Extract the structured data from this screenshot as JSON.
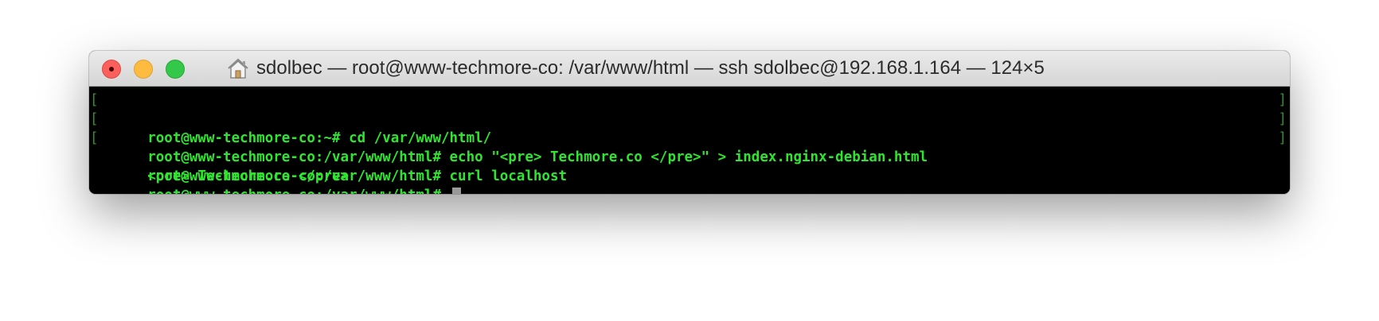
{
  "window": {
    "title": "sdolbec — root@www-techmore-co: /var/www/html — ssh sdolbec@192.168.1.164 — 124×5",
    "icon": "home-icon"
  },
  "terminal": {
    "colors": {
      "background": "#000000",
      "text": "#2ee62e",
      "cursor": "#9a9a9a"
    },
    "lines": [
      {
        "text": "root@www-techmore-co:~# cd /var/www/html/",
        "bracketed": true
      },
      {
        "text": "root@www-techmore-co:/var/www/html# echo \"<pre> Techmore.co </pre>\" > index.nginx-debian.html",
        "bracketed": true
      },
      {
        "text": "root@www-techmore-co:/var/www/html# curl localhost",
        "bracketed": true
      },
      {
        "text": "<pre> Techmore.co </pre>",
        "bracketed": false
      },
      {
        "text": "root@www-techmore-co:/var/www/html# ",
        "bracketed": false
      }
    ]
  }
}
